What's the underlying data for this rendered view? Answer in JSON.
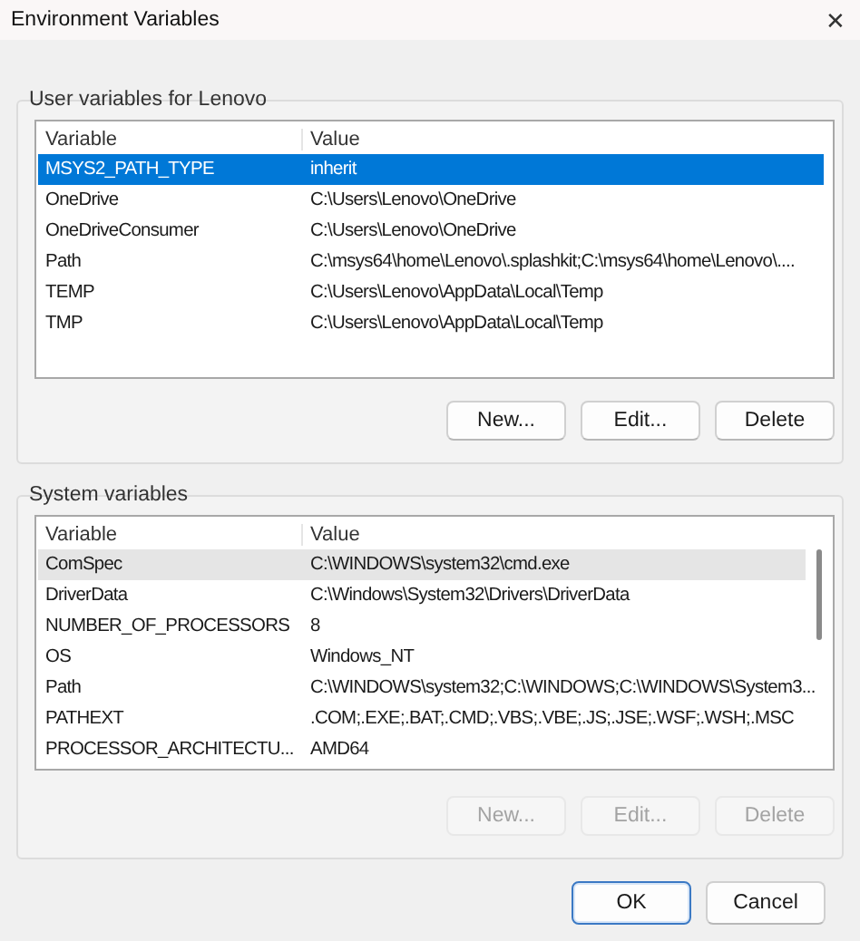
{
  "window": {
    "title": "Environment Variables",
    "close": "✕"
  },
  "groups": [
    {
      "title": "User variables for Lenovo",
      "focused": true,
      "scrollbar": false,
      "columns": [
        "Variable",
        "Value"
      ],
      "rows": [
        {
          "variable": "MSYS2_PATH_TYPE",
          "value": "inherit",
          "selected": true
        },
        {
          "variable": "OneDrive",
          "value": "C:\\Users\\Lenovo\\OneDrive",
          "selected": false
        },
        {
          "variable": "OneDriveConsumer",
          "value": "C:\\Users\\Lenovo\\OneDrive",
          "selected": false
        },
        {
          "variable": "Path",
          "value": "C:\\msys64\\home\\Lenovo\\.splashkit;C:\\msys64\\home\\Lenovo\\....",
          "selected": false
        },
        {
          "variable": "TEMP",
          "value": "C:\\Users\\Lenovo\\AppData\\Local\\Temp",
          "selected": false
        },
        {
          "variable": "TMP",
          "value": "C:\\Users\\Lenovo\\AppData\\Local\\Temp",
          "selected": false
        }
      ],
      "buttons": [
        {
          "label": "New...",
          "disabled": false
        },
        {
          "label": "Edit...",
          "disabled": false
        },
        {
          "label": "Delete",
          "disabled": false
        }
      ]
    },
    {
      "title": "System variables",
      "focused": false,
      "scrollbar": true,
      "columns": [
        "Variable",
        "Value"
      ],
      "rows": [
        {
          "variable": "ComSpec",
          "value": "C:\\WINDOWS\\system32\\cmd.exe",
          "selected": true
        },
        {
          "variable": "DriverData",
          "value": "C:\\Windows\\System32\\Drivers\\DriverData",
          "selected": false
        },
        {
          "variable": "NUMBER_OF_PROCESSORS",
          "value": "8",
          "selected": false
        },
        {
          "variable": "OS",
          "value": "Windows_NT",
          "selected": false
        },
        {
          "variable": "Path",
          "value": "C:\\WINDOWS\\system32;C:\\WINDOWS;C:\\WINDOWS\\System3...",
          "selected": false
        },
        {
          "variable": "PATHEXT",
          "value": ".COM;.EXE;.BAT;.CMD;.VBS;.VBE;.JS;.JSE;.WSF;.WSH;.MSC",
          "selected": false
        },
        {
          "variable": "PROCESSOR_ARCHITECTU...",
          "value": "AMD64",
          "selected": false
        }
      ],
      "buttons": [
        {
          "label": "New...",
          "disabled": true
        },
        {
          "label": "Edit...",
          "disabled": true
        },
        {
          "label": "Delete",
          "disabled": true
        }
      ]
    }
  ],
  "dialog_buttons": [
    {
      "label": "OK",
      "default": true
    },
    {
      "label": "Cancel",
      "default": false
    }
  ]
}
